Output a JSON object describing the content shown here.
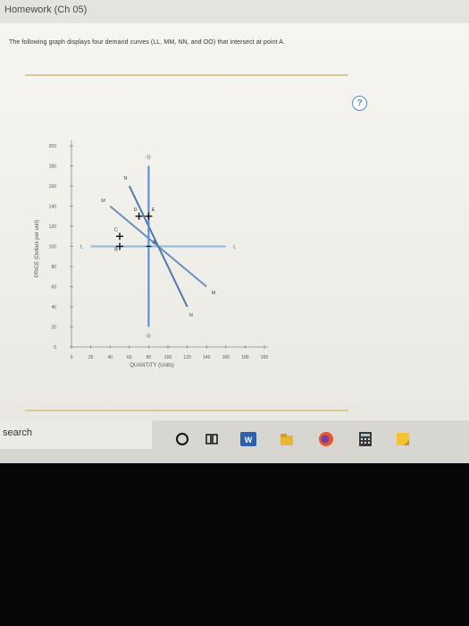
{
  "page": {
    "title": "Homework (Ch 05)",
    "intro": "The following graph displays four demand curves (LL, MM, NN, and OO) that intersect at point A.",
    "help_label": "?"
  },
  "chart_data": {
    "type": "line",
    "xlabel": "QUANTITY (Units)",
    "ylabel": "PRICE (Dollars per unit)",
    "xlim": [
      0,
      200
    ],
    "ylim": [
      0,
      200
    ],
    "xticks": [
      0,
      20,
      40,
      60,
      80,
      100,
      120,
      140,
      160,
      180,
      200
    ],
    "yticks": [
      0,
      20,
      40,
      60,
      80,
      100,
      120,
      140,
      160,
      180,
      200
    ],
    "series": [
      {
        "name": "L",
        "color": "#8fb9da",
        "points": [
          [
            20,
            100
          ],
          [
            160,
            100
          ]
        ],
        "end_labels": [
          "L",
          "L"
        ]
      },
      {
        "name": "M",
        "color": "#6d8fbd",
        "points": [
          [
            40,
            140
          ],
          [
            140,
            60
          ]
        ],
        "end_labels": [
          "M",
          "M"
        ]
      },
      {
        "name": "N",
        "color": "#4f77ab",
        "points": [
          [
            60,
            160
          ],
          [
            120,
            40
          ]
        ],
        "end_labels": [
          "N",
          "N"
        ]
      },
      {
        "name": "O",
        "color": "#4d8bd8",
        "points": [
          [
            80,
            180
          ],
          [
            80,
            20
          ]
        ],
        "end_labels": [
          "O",
          "O"
        ]
      }
    ],
    "points": [
      {
        "label": "A",
        "x": 80,
        "y": 100
      },
      {
        "label": "B",
        "x": 50,
        "y": 100
      },
      {
        "label": "C",
        "x": 50,
        "y": 110
      },
      {
        "label": "D",
        "x": 70,
        "y": 130
      },
      {
        "label": "E",
        "x": 80,
        "y": 130
      }
    ]
  },
  "taskbar": {
    "search_label": "search",
    "icons": [
      "cortana-icon",
      "task-view-icon",
      "word-icon",
      "file-explorer-icon",
      "firefox-icon",
      "calculator-icon",
      "sticky-notes-icon"
    ]
  }
}
